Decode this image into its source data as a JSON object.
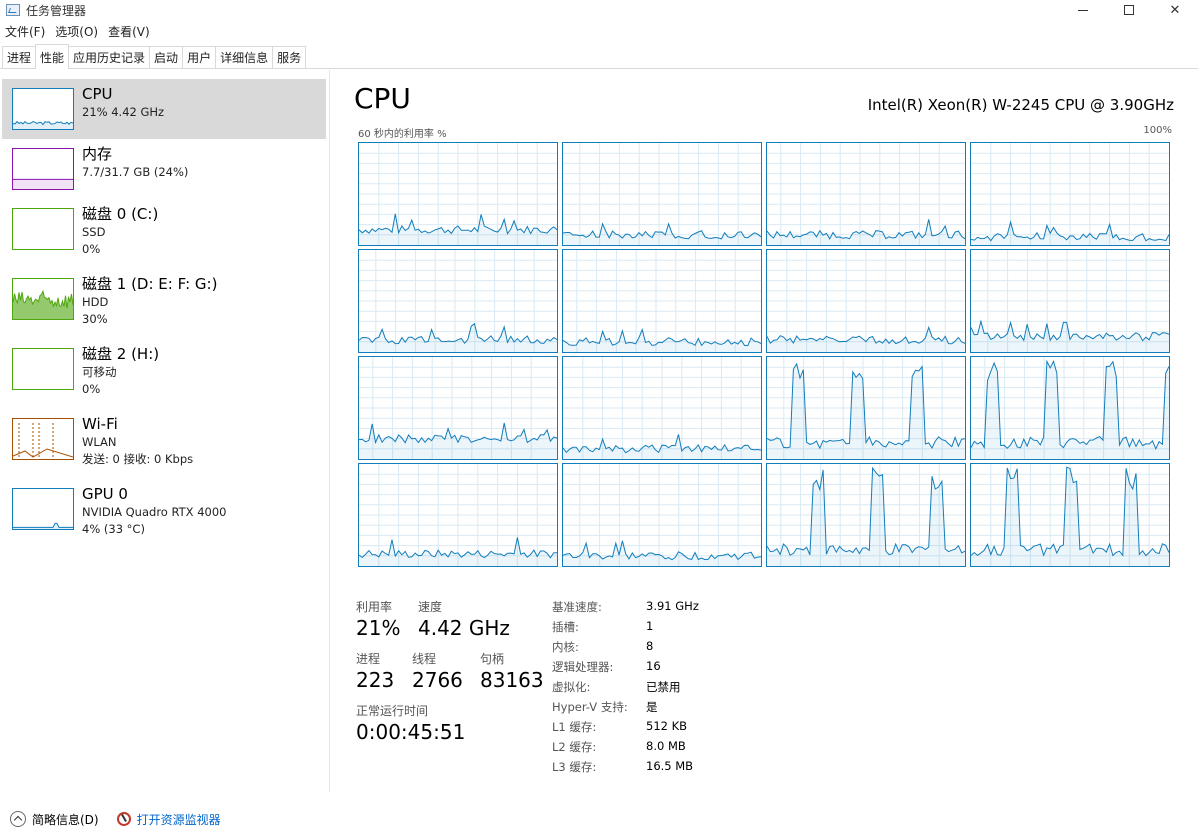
{
  "window": {
    "title": "任务管理器"
  },
  "menu": [
    "文件(F)",
    "选项(O)",
    "查看(V)"
  ],
  "tabs": [
    "进程",
    "性能",
    "应用历史记录",
    "启动",
    "用户",
    "详细信息",
    "服务"
  ],
  "active_tab": "性能",
  "sidebar": [
    {
      "title": "CPU",
      "sub1": "21% 4.42 GHz",
      "sub2": "",
      "color": "#117dbb",
      "active": true
    },
    {
      "title": "内存",
      "sub1": "7.7/31.7 GB (24%)",
      "sub2": "",
      "color": "#8b12ae",
      "active": false
    },
    {
      "title": "磁盘 0 (C:)",
      "sub1": "SSD",
      "sub2": "0%",
      "color": "#4da60c",
      "active": false
    },
    {
      "title": "磁盘 1 (D: E: F: G:)",
      "sub1": "HDD",
      "sub2": "30%",
      "color": "#4da60c",
      "active": false
    },
    {
      "title": "磁盘 2 (H:)",
      "sub1": "可移动",
      "sub2": "0%",
      "color": "#4da60c",
      "active": false
    },
    {
      "title": "Wi-Fi",
      "sub1": "WLAN",
      "sub2": "发送: 0 接收: 0 Kbps",
      "color": "#a74f01",
      "active": false
    },
    {
      "title": "GPU 0",
      "sub1": "NVIDIA Quadro RTX 4000",
      "sub2": "4% (33 °C)",
      "color": "#117dbb",
      "active": false
    }
  ],
  "main": {
    "title": "CPU",
    "model": "Intel(R) Xeon(R) W-2245 CPU @ 3.90GHz",
    "graph_caption": "60 秒内的利用率 %",
    "graph_max": "100%",
    "accent": "#117dbb",
    "grid_color": "#d9eaf4"
  },
  "stats": {
    "util_label": "利用率",
    "util_value": "21%",
    "speed_label": "速度",
    "speed_value": "4.42 GHz",
    "proc_label": "进程",
    "proc_value": "223",
    "thread_label": "线程",
    "thread_value": "2766",
    "handle_label": "句柄",
    "handle_value": "83163",
    "uptime_label": "正常运行时间",
    "uptime_value": "0:00:45:51"
  },
  "info": [
    {
      "k": "基准速度:",
      "v": "3.91 GHz"
    },
    {
      "k": "插槽:",
      "v": "1"
    },
    {
      "k": "内核:",
      "v": "8"
    },
    {
      "k": "逻辑处理器:",
      "v": "16"
    },
    {
      "k": "虚拟化:",
      "v": "已禁用"
    },
    {
      "k": "Hyper-V 支持:",
      "v": "是"
    },
    {
      "k": "L1 缓存:",
      "v": "512 KB"
    },
    {
      "k": "L2 缓存:",
      "v": "8.0 MB"
    },
    {
      "k": "L3 缓存:",
      "v": "16.5 MB"
    }
  ],
  "footer": {
    "details_label": "简略信息(D)",
    "monitor_label": "打开资源监视器"
  },
  "core_levels": [
    0.15,
    0.1,
    0.1,
    0.08,
    0.12,
    0.1,
    0.12,
    0.15,
    0.2,
    0.1,
    0.5,
    0.5,
    0.12,
    0.1,
    0.55,
    0.55
  ]
}
